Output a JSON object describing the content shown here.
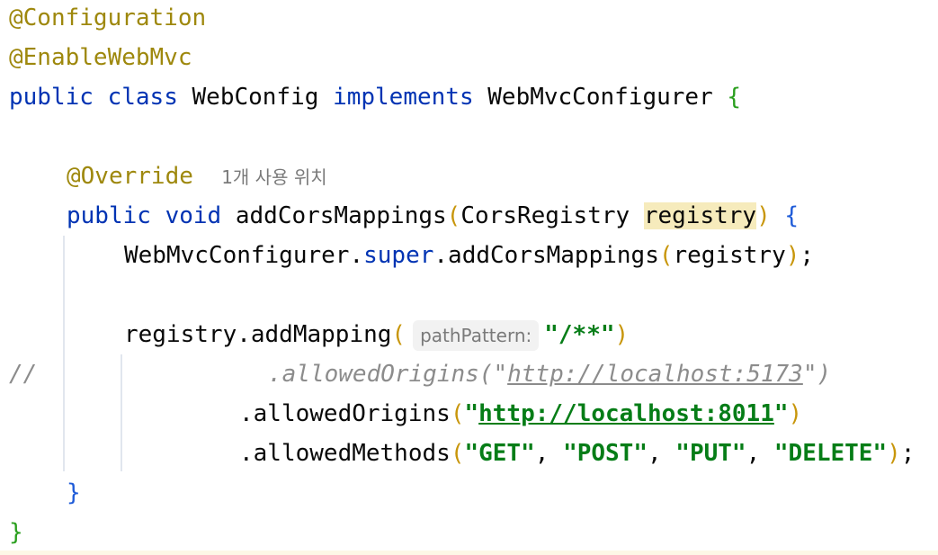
{
  "code": {
    "line1": {
      "annotation": "@Configuration"
    },
    "line2": {
      "annotation": "@EnableWebMvc"
    },
    "line3": {
      "kw_public": "public",
      "kw_class": "class",
      "class_name": "WebConfig",
      "kw_implements": "implements",
      "interface_name": "WebMvcConfigurer",
      "open_brace": "{"
    },
    "line5": {
      "annotation": "@Override",
      "usage_hint": "1개 사용 위치"
    },
    "line6": {
      "kw_public": "public",
      "kw_void": "void",
      "method_name": "addCorsMappings",
      "open_paren": "(",
      "param_type": "CorsRegistry",
      "param_name": "registry",
      "close_paren": ")",
      "open_brace": "{"
    },
    "line7": {
      "target": "WebMvcConfigurer.",
      "kw_super": "super",
      "call": ".addCorsMappings",
      "open_paren": "(",
      "arg": "registry",
      "close_paren": ")",
      "semicolon": ";"
    },
    "line9": {
      "call": "registry.addMapping",
      "open_paren": "(",
      "param_hint": "pathPattern:",
      "arg": "\"/**\"",
      "close_paren": ")"
    },
    "line10": {
      "comment_marker": "//",
      "comment_call": ".allowedOrigins(\"",
      "comment_url": "http://localhost:5173",
      "comment_end": "\")"
    },
    "line11": {
      "call": ".allowedOrigins",
      "open_paren": "(",
      "quote_open": "\"",
      "url": "http://localhost:8011",
      "quote_close": "\"",
      "close_paren": ")"
    },
    "line12": {
      "call": ".allowedMethods",
      "open_paren": "(",
      "arg1": "\"GET\"",
      "sep1": ", ",
      "arg2": "\"POST\"",
      "sep2": ", ",
      "arg3": "\"PUT\"",
      "sep3": ", ",
      "arg4": "\"DELETE\"",
      "close_paren": ")",
      "semicolon": ";"
    },
    "line13": {
      "close_brace": "}"
    },
    "line14": {
      "close_brace": "}"
    }
  },
  "colors": {
    "annotation": "#9e880d",
    "keyword": "#0033b3",
    "string": "#067d17",
    "comment": "#8c8c8c",
    "paren": "#c8960b",
    "highlight": "#f6ebbc"
  }
}
